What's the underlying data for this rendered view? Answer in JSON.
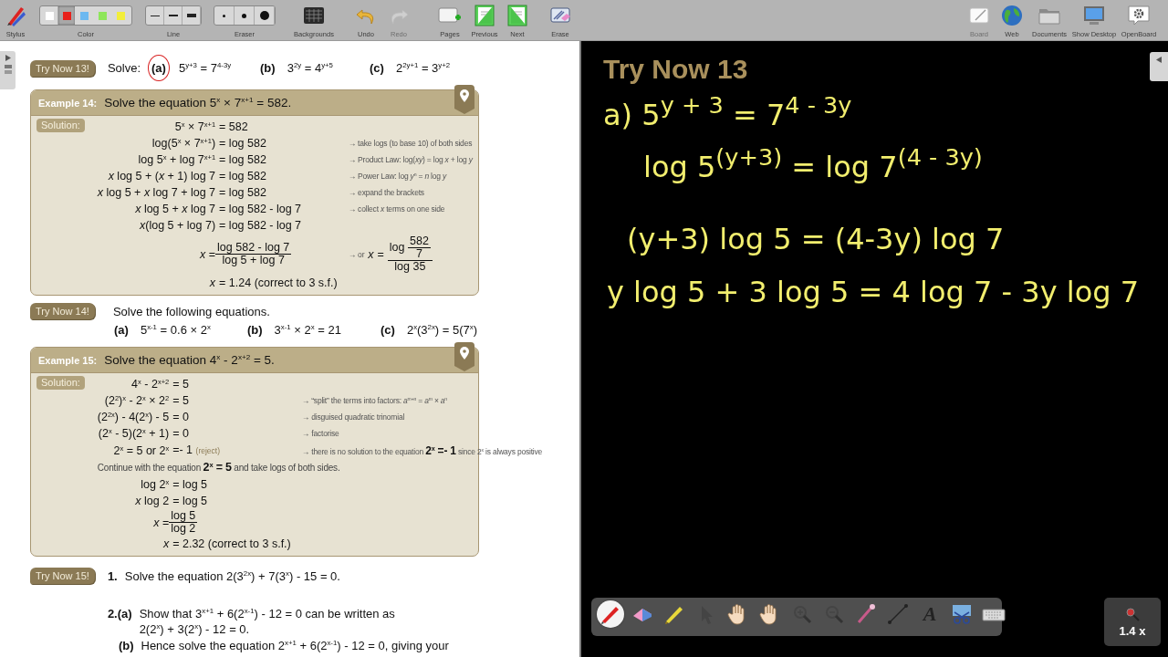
{
  "top_toolbar": {
    "left_tools": [
      {
        "kind": "stylus",
        "label": "Stylus",
        "disabled": false
      },
      {
        "kind": "colors",
        "label": "Color",
        "disabled": false,
        "swatches": [
          {
            "color": "#ffffff",
            "selected": false
          },
          {
            "color": "#e8211b",
            "selected": true
          },
          {
            "color": "#6cb8f0",
            "selected": false
          },
          {
            "color": "#8ee65a",
            "selected": false
          },
          {
            "color": "#f2ee3a",
            "selected": false
          }
        ]
      },
      {
        "kind": "lines",
        "label": "Line",
        "disabled": false
      },
      {
        "kind": "eraser",
        "label": "Eraser",
        "disabled": false
      },
      {
        "kind": "backgrounds",
        "label": "Backgrounds",
        "disabled": false
      },
      {
        "kind": "undo",
        "label": "Undo",
        "disabled": false
      },
      {
        "kind": "redo",
        "label": "Redo",
        "disabled": true
      },
      {
        "kind": "pages",
        "label": "Pages",
        "disabled": false
      },
      {
        "kind": "previous",
        "label": "Previous",
        "disabled": false
      },
      {
        "kind": "next",
        "label": "Next",
        "disabled": false
      },
      {
        "kind": "erase",
        "label": "Erase",
        "disabled": false
      }
    ],
    "right_tools": [
      {
        "kind": "board",
        "label": "Board",
        "disabled": true
      },
      {
        "kind": "web",
        "label": "Web",
        "disabled": false
      },
      {
        "kind": "documents",
        "label": "Documents",
        "disabled": false
      },
      {
        "kind": "desktop",
        "label": "Show Desktop",
        "disabled": false
      },
      {
        "kind": "openboard",
        "label": "OpenBoard",
        "disabled": false
      }
    ]
  },
  "document": {
    "blocks": [
      {
        "kind": "try_inline",
        "badge": "Try Now 13!",
        "prompt": "Solve:",
        "parts": [
          {
            "label": "(a)",
            "math": "5$^{y+3}$ = 7$^{4-3y}$",
            "circled": true
          },
          {
            "label": "(b)",
            "math": "3$^{2y}$ = 4$^{y+5}$",
            "circled": false
          },
          {
            "label": "(c)",
            "math": "2$^{2y+1}$ = 3$^{y+2}$",
            "circled": false
          }
        ]
      },
      {
        "kind": "example",
        "heading": "Example 14:",
        "title": "Solve the equation  5$^{x}$ × 7$^{x+1}$ = 582.",
        "solution_label": "Solution:",
        "steps": [
          {
            "kind": "split",
            "lhs": "5$^{x}$ × 7$^{x+1}$",
            "rhs": "= 582"
          },
          {
            "kind": "split",
            "lhs": "log(5$^{x}$ × 7$^{x+1}$)",
            "rhs": "= log 582",
            "note": "→ take logs (to base 10) of both sides"
          },
          {
            "kind": "split",
            "lhs": "log 5$^{x}$ + log 7$^{x+1}$",
            "rhs": "= log 582",
            "note": "→ Product Law:  log(*xy*) = log *x* + log *y*"
          },
          {
            "kind": "split",
            "lhs": "*x* log 5 + (*x* + 1) log 7",
            "rhs": "= log 582",
            "note": "→  Power Law:  log *y*$^{n}$ = *n* log *y*"
          },
          {
            "kind": "split",
            "lhs": "*x* log 5 + *x* log 7 + log 7",
            "rhs": "= log 582",
            "note": "→ expand the brackets"
          },
          {
            "kind": "split",
            "lhs": "*x* log 5 + *x* log 7",
            "rhs": "= log 582 - log 7",
            "note": "→ collect *x* terms on one side"
          },
          {
            "kind": "split",
            "lhs": "*x*(log 5 + log 7)",
            "rhs": "= log 582 - log 7"
          },
          {
            "kind": "fraction",
            "lhs": "*x* =",
            "num": "log 582 - log 7",
            "den": "log 5 + log 7",
            "note": "→ or",
            "alt_lhs": "*x* =",
            "alt_num": "log",
            "alt_num_num": "582",
            "alt_num_den": "7",
            "alt_den": "log 35"
          },
          {
            "kind": "split",
            "lhs": "*x*",
            "rhs": "= 1.24  (correct to 3 s.f.)"
          }
        ]
      },
      {
        "kind": "try_list",
        "badge": "Try Now 14!",
        "prompt": "Solve the following equations.",
        "parts": [
          {
            "label": "(a)",
            "math": "5$^{x-1}$ = 0.6 × 2$^{x}$",
            "circled": false
          },
          {
            "label": "(b)",
            "math": "3$^{x-1}$ × 2$^{x}$ = 21",
            "circled": false
          },
          {
            "label": "(c)",
            "math": "2$^{x}$(3$^{2x}$) = 5(7$^{x}$)",
            "circled": false
          }
        ]
      },
      {
        "kind": "example",
        "heading": "Example 15:",
        "title": "Solve the equation  4$^{x}$ - 2$^{x+2}$ = 5.",
        "solution_label": "Solution:",
        "steps": [
          {
            "kind": "split",
            "lhs": "4$^{x}$ - 2$^{x+2}$",
            "rhs": "= 5"
          },
          {
            "kind": "split",
            "lhs": "(2$^{2}$)$^{x}$ - 2$^{x}$ × 2$^{2}$",
            "rhs": "= 5",
            "note": "→ “split” the terms into factors:  *a*$^{m+n}$ = *a*$^{m}$ × *a*$^{n}$"
          },
          {
            "kind": "split",
            "lhs": "(2$^{2x}$) - 4(2$^{x}$) - 5",
            "rhs": "= 0",
            "note": "→ disguised quadratic trinomial"
          },
          {
            "kind": "split",
            "lhs": "(2$^{x}$ - 5)(2$^{x}$ + 1)",
            "rhs": "= 0",
            "note": "→ factorise"
          },
          {
            "kind": "split",
            "lhs": "2$^{x}$ = 5  or  2$^{x}$",
            "rhs": "=- 1",
            "remark": "(reject)",
            "note": "→ there is no solution to the equation  **2$^{x}$ =- 1**  since 2$^{x}$ is always positive"
          },
          {
            "kind": "text",
            "text": "Continue with the equation  **2$^{x}$ = 5**  and take logs of both sides."
          },
          {
            "kind": "split",
            "lhs": "log 2$^{x}$",
            "rhs": "= log 5"
          },
          {
            "kind": "split",
            "lhs": "*x* log 2",
            "rhs": "= log 5"
          },
          {
            "kind": "fraction",
            "lhs": "*x* =",
            "num": "log 5",
            "den": "log 2"
          },
          {
            "kind": "split",
            "lhs": "*x*",
            "rhs": "= 2.32  (correct to 3 s.f.)"
          }
        ]
      },
      {
        "kind": "try_numbered",
        "badge": "Try Now 15!",
        "items": [
          {
            "number": "1.",
            "text": "Solve the equation  2(3$^{2x}$) + 7(3$^{x}$) - 15 = 0."
          },
          {
            "number": "2.",
            "sub": "(a)",
            "text": "Show that  3$^{x+1}$ + 6(2$^{x-1}$) - 12 = 0  can be written as",
            "continuation": "2(2$^{x}$) + 3(2$^{x}$) - 12 = 0."
          },
          {
            "sub": "(b)",
            "text": "Hence solve the equation  2$^{x+1}$ + 6(2$^{x-1}$) - 12 = 0, giving your"
          }
        ]
      }
    ]
  },
  "board": {
    "title": "Try Now 13",
    "ink_lines": [
      "a)  5$^{y + 3}$ = 7$^{4 - 3y}$",
      "log 5$^{(y+3)}$ = log 7$^{(4 - 3y)}$",
      "(y+3) log 5 = (4-3y) log 7",
      "y log 5 + 3 log 5 = 4 log 7 - 3y log 7"
    ]
  },
  "floating_tools": [
    {
      "kind": "pen",
      "selected": true
    },
    {
      "kind": "eraser",
      "selected": false
    },
    {
      "kind": "marker",
      "selected": false
    },
    {
      "kind": "pointer",
      "selected": false
    },
    {
      "kind": "hand",
      "selected": false
    },
    {
      "kind": "hand",
      "selected": false
    },
    {
      "kind": "zoom_in",
      "selected": false
    },
    {
      "kind": "zoom_out",
      "selected": false
    },
    {
      "kind": "laser",
      "selected": false
    },
    {
      "kind": "line",
      "selected": false
    },
    {
      "kind": "text",
      "glyph": "A",
      "selected": false
    },
    {
      "kind": "capture",
      "selected": false
    },
    {
      "kind": "keyboard",
      "selected": false
    }
  ],
  "zoom": {
    "label": "1.4 x"
  }
}
